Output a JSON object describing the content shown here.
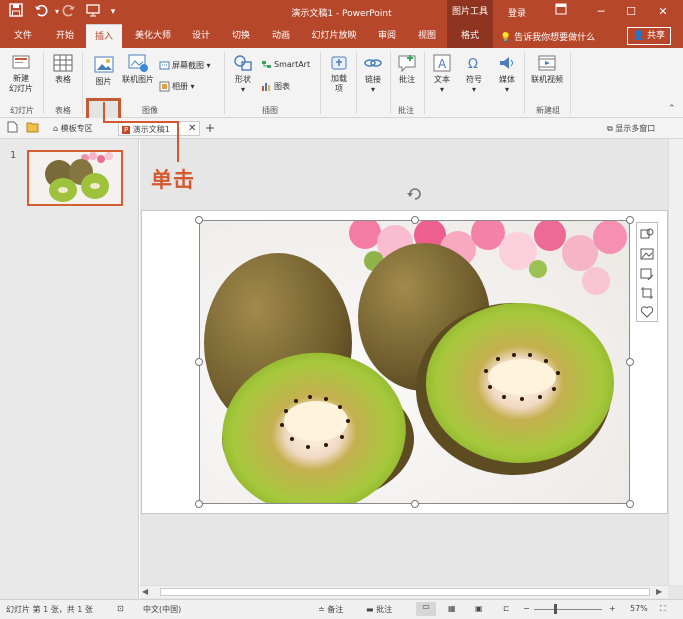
{
  "title_bar": {
    "doc_title": "演示文稿1 - PowerPoint",
    "context_tab_header": "图片工具",
    "login": "登录",
    "win_icons": [
      "ribbon-display-icon",
      "minimize-icon",
      "maximize-icon",
      "close-icon"
    ]
  },
  "qat": [
    "save-icon",
    "undo-icon",
    "redo-icon",
    "present-icon",
    "customize-icon"
  ],
  "tabs": [
    "文件",
    "开始",
    "插入",
    "美化大师",
    "设计",
    "切换",
    "动画",
    "幻灯片放映",
    "审阅",
    "视图",
    "格式"
  ],
  "active_tab": "插入",
  "tellme": "告诉我你想要做什么",
  "share": "共享",
  "ribbon": {
    "new_slide": "新建\n幻灯片",
    "table": "表格",
    "picture": "图片",
    "online_picture": "联机图片",
    "screenshot": "屏幕截图",
    "album": "相册",
    "shapes": "形状",
    "smartart": "SmartArt",
    "chart": "图表",
    "addins": "加载\n项",
    "link": "链接",
    "comment": "批注",
    "text": "文本",
    "symbol": "符号",
    "media": "媒体",
    "online_video": "联机视频",
    "groups": [
      "幻灯片",
      "表格",
      "图像",
      "插图",
      "批注",
      "新建组"
    ]
  },
  "doctabs": {
    "template": "模板专区",
    "doc": "演示文稿1",
    "multi_window": "显示多窗口"
  },
  "slide_number": "1",
  "callout": "单击",
  "statusbar": {
    "slide_info": "幻灯片 第 1 张，共 1 张",
    "language": "中文(中国)",
    "notes": "备注",
    "comments": "批注",
    "zoom": "57%"
  },
  "colors": {
    "accent": "#b7472a",
    "highlight": "#d4582f"
  }
}
